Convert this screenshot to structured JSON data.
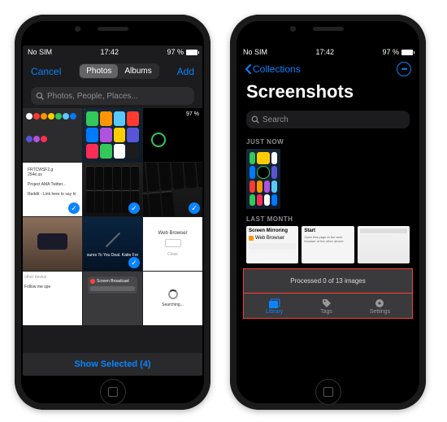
{
  "status": {
    "carrier": "No SIM",
    "time": "17:42",
    "battery_pct": "97 %"
  },
  "picker": {
    "cancel": "Cancel",
    "add": "Add",
    "segments": {
      "photos": "Photos",
      "albums": "Albums"
    },
    "search_placeholder": "Photos, People, Places...",
    "show_selected": "Show Selected (4)"
  },
  "album": {
    "back": "Collections",
    "title": "Screenshots",
    "search_placeholder": "Search",
    "sections": {
      "just_now": "JUST NOW",
      "last_month": "LAST MONTH"
    },
    "cards": [
      {
        "title": "Screen Mirroring",
        "sub": "Web Browser"
      },
      {
        "title": "Start",
        "sub": "Open this page in the web browser of the other device"
      },
      {
        "title": ""
      }
    ],
    "toast": "Processed 0 of 13 images",
    "tabs": {
      "library": "Library",
      "tags": "Tags",
      "settings": "Settings"
    }
  }
}
